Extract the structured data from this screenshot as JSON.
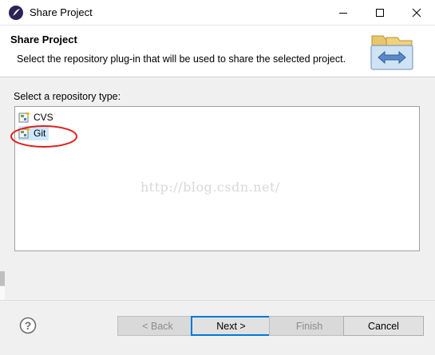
{
  "window": {
    "title": "Share Project"
  },
  "header": {
    "title": "Share Project",
    "description": "Select the repository plug-in that will be used to share the selected project."
  },
  "repository": {
    "label": "Select a repository type:",
    "items": [
      {
        "label": "CVS",
        "icon": "repository-plugin-icon"
      },
      {
        "label": "Git",
        "icon": "repository-plugin-icon",
        "selected": true
      }
    ]
  },
  "watermark": "http://blog.csdn.net/",
  "buttons": {
    "back": "< Back",
    "next": "Next >",
    "finish": "Finish",
    "cancel": "Cancel"
  },
  "colors": {
    "selection": "#cce8ff",
    "default_button_border": "#0078d7",
    "annotation": "#e02020"
  }
}
